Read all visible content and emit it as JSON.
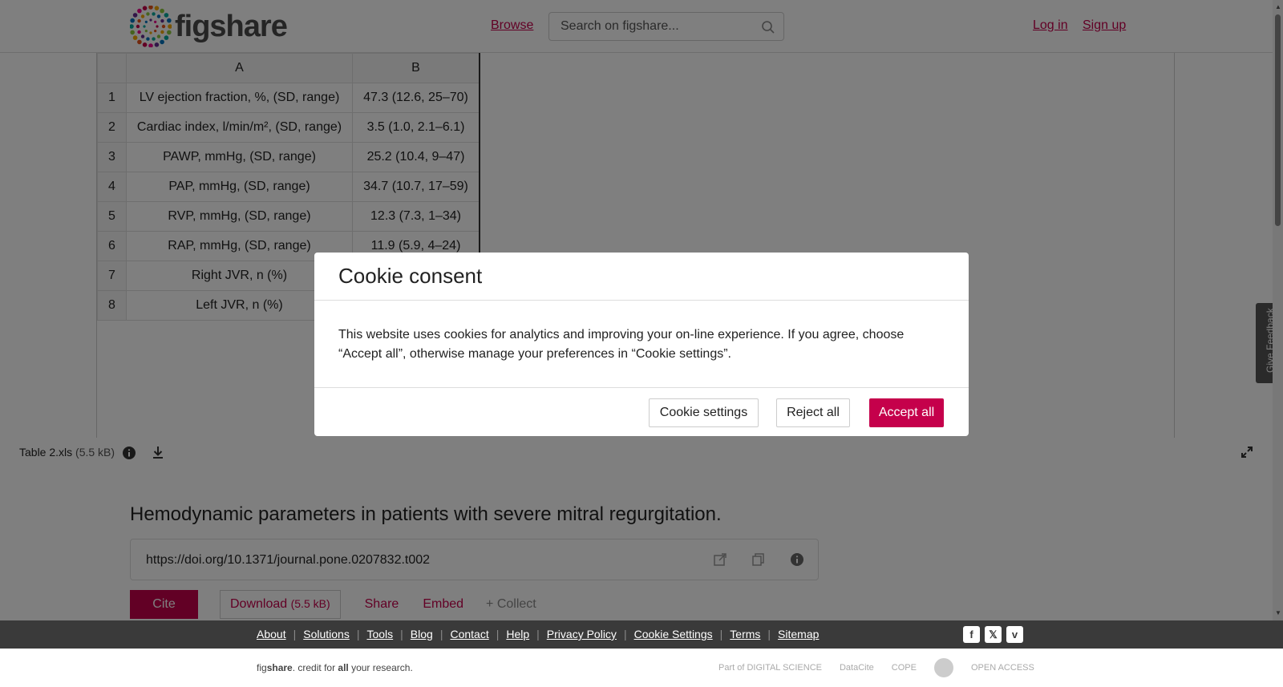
{
  "header": {
    "logo_text": "figshare",
    "browse": "Browse",
    "search_placeholder": "Search on figshare...",
    "login": "Log in",
    "signup": "Sign up"
  },
  "sheet": {
    "columns": [
      "",
      "A",
      "B"
    ],
    "rows": [
      {
        "n": "1",
        "a": "LV ejection fraction, %, (SD, range)",
        "b": "47.3 (12.6, 25–70)"
      },
      {
        "n": "2",
        "a": "Cardiac index, l/min/m², (SD, range)",
        "b": "3.5 (1.0, 2.1–6.1)"
      },
      {
        "n": "3",
        "a": "PAWP, mmHg, (SD, range)",
        "b": "25.2 (10.4, 9–47)"
      },
      {
        "n": "4",
        "a": "PAP, mmHg, (SD, range)",
        "b": "34.7 (10.7, 17–59)"
      },
      {
        "n": "5",
        "a": "RVP, mmHg, (SD, range)",
        "b": "12.3 (7.3, 1–34)"
      },
      {
        "n": "6",
        "a": "RAP, mmHg, (SD, range)",
        "b": "11.9 (5.9, 4–24)"
      },
      {
        "n": "7",
        "a": "Right JVR, n (%)",
        "b": ""
      },
      {
        "n": "8",
        "a": "Left JVR, n (%)",
        "b": ""
      }
    ]
  },
  "file_bar": {
    "file_name": "Table 2.xls",
    "file_size": "(5.5 kB)"
  },
  "content": {
    "title": "Hemodynamic parameters in patients with severe mitral regurgitation.",
    "doi": "https://doi.org/10.1371/journal.pone.0207832.t002",
    "cite": "Cite",
    "download": "Download",
    "download_size": "(5.5 kB)",
    "share": "Share",
    "embed": "Embed",
    "collect": "+ Collect"
  },
  "footer": {
    "links": [
      "About",
      "Solutions",
      "Tools",
      "Blog",
      "Contact",
      "Help",
      "Privacy Policy",
      "Cookie Settings",
      "Terms",
      "Sitemap"
    ],
    "tagline_pre": "fig",
    "tagline_brand": "share",
    "tagline_mid": ". credit for ",
    "tagline_all": "all",
    "tagline_post": " your research.",
    "partners": [
      "Part of DIGITAL SCIENCE",
      "DataCite",
      "COPE",
      "",
      "OPEN ACCESS"
    ]
  },
  "feedback": "Give Feedback",
  "modal": {
    "title": "Cookie consent",
    "body": "This website uses cookies for analytics and improving your on-line experience. If you agree, choose “Accept all”, otherwise manage your preferences in “Cookie settings”.",
    "settings": "Cookie settings",
    "reject": "Reject all",
    "accept": "Accept all"
  },
  "colors": {
    "brand": "#c5004b",
    "footer_bg": "#3a3a3a"
  }
}
